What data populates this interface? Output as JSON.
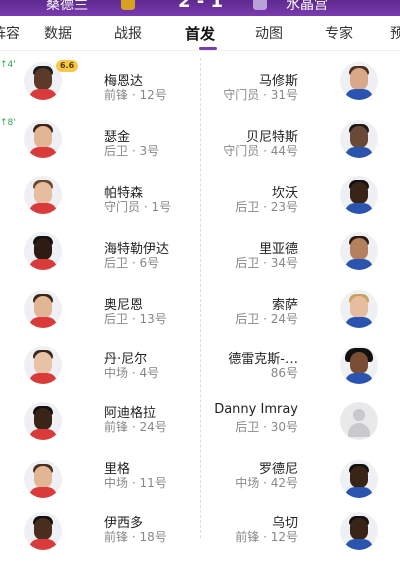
{
  "header": {
    "home_team": "桑德兰",
    "score": "2 - 1",
    "away_team": "水晶宫"
  },
  "tabs": [
    {
      "label": "阵容"
    },
    {
      "label": "数据"
    },
    {
      "label": "战报"
    },
    {
      "label": "首发"
    },
    {
      "label": "动图"
    },
    {
      "label": "专家"
    },
    {
      "label": "预测"
    }
  ],
  "home_lineup": [
    {
      "name": "梅恩达",
      "detail": "前锋 · 12号",
      "rating": "6.6",
      "sub_minute": "4'"
    },
    {
      "name": "瑟金",
      "detail": "后卫 · 3号",
      "sub_minute": "8'"
    },
    {
      "name": "帕特森",
      "detail": "守门员 · 1号"
    },
    {
      "name": "海特勒伊达",
      "detail": "后卫 · 6号"
    },
    {
      "name": "奥尼恩",
      "detail": "后卫 · 13号"
    },
    {
      "name": "丹·尼尔",
      "detail": "中场 · 4号"
    },
    {
      "name": "阿迪格拉",
      "detail": "前锋 · 24号"
    },
    {
      "name": "里格",
      "detail": "中场 · 11号"
    },
    {
      "name": "伊西多",
      "detail": "前锋 · 18号"
    }
  ],
  "away_lineup": [
    {
      "name": "马修斯",
      "detail": "守门员 · 31号"
    },
    {
      "name": "贝尼特斯",
      "detail": "守门员 · 44号"
    },
    {
      "name": "坎沃",
      "detail": "后卫 · 23号"
    },
    {
      "name": "里亚德",
      "detail": "后卫 · 34号"
    },
    {
      "name": "索萨",
      "detail": "后卫 · 24号"
    },
    {
      "name": "德雷克斯-…",
      "detail": "86号"
    },
    {
      "name": "Danny Imray",
      "detail": "后卫 · 30号"
    },
    {
      "name": "罗德尼",
      "detail": "中场 · 42号"
    },
    {
      "name": "乌切",
      "detail": "前锋 · 12号"
    }
  ],
  "colors": {
    "header_bg": "#7a3bb0",
    "tab_active_underline": "#7a3bb0",
    "rating_badge": "#f6c84a",
    "sub_arrow": "#2fa84f",
    "detail_text": "#888888"
  }
}
